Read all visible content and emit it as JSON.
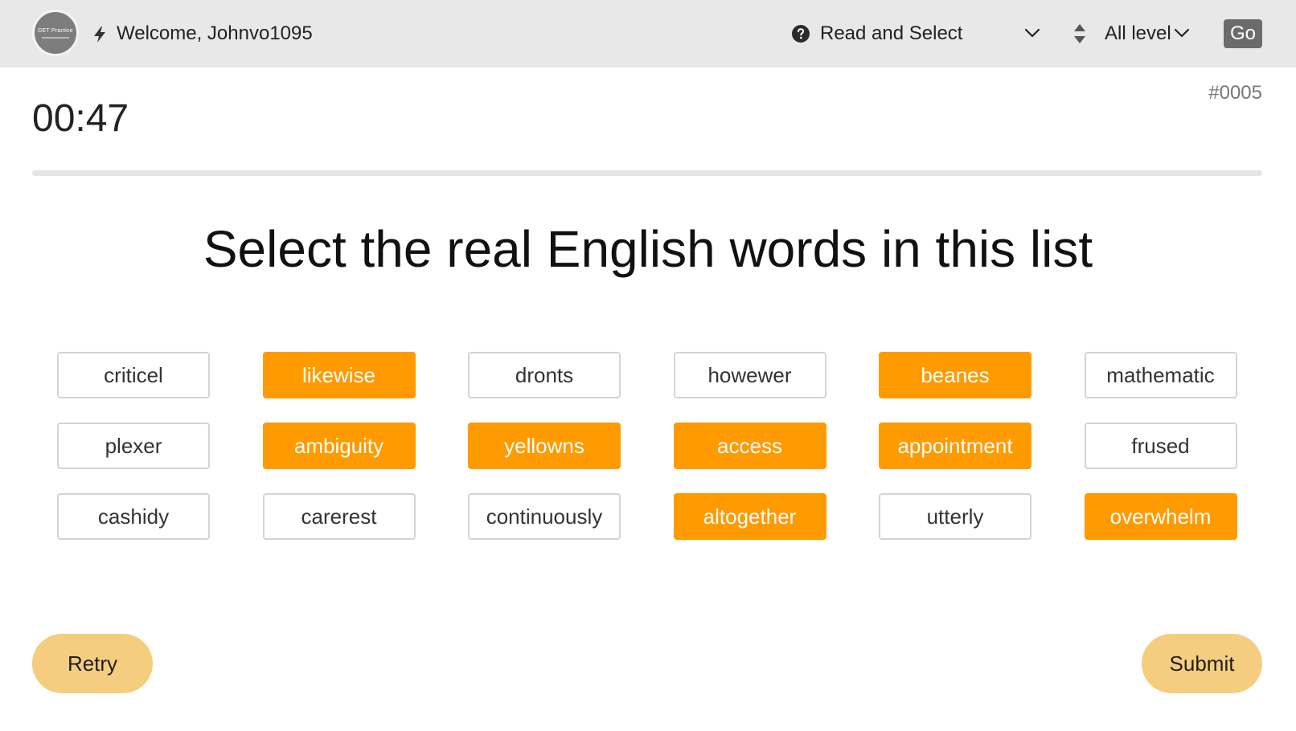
{
  "header": {
    "logo_text": "DET Practice",
    "welcome": "Welcome, Johnvo1095",
    "question_type": "Read and Select",
    "level": "All level",
    "go_label": "Go"
  },
  "question": {
    "id": "#0005",
    "timer": "00:47",
    "progress": 0,
    "prompt": "Select the real English words in this list"
  },
  "words": [
    {
      "label": "criticel",
      "selected": false
    },
    {
      "label": "likewise",
      "selected": true
    },
    {
      "label": "dronts",
      "selected": false
    },
    {
      "label": "howewer",
      "selected": false
    },
    {
      "label": "beanes",
      "selected": true
    },
    {
      "label": "mathematic",
      "selected": false
    },
    {
      "label": "plexer",
      "selected": false
    },
    {
      "label": "ambiguity",
      "selected": true
    },
    {
      "label": "yellowns",
      "selected": true
    },
    {
      "label": "access",
      "selected": true
    },
    {
      "label": "appointment",
      "selected": true
    },
    {
      "label": "frused",
      "selected": false
    },
    {
      "label": "cashidy",
      "selected": false
    },
    {
      "label": "carerest",
      "selected": false
    },
    {
      "label": "continuously",
      "selected": false
    },
    {
      "label": "altogether",
      "selected": true
    },
    {
      "label": "utterly",
      "selected": false
    },
    {
      "label": "overwhelm",
      "selected": true
    }
  ],
  "actions": {
    "retry_label": "Retry",
    "submit_label": "Submit"
  },
  "colors": {
    "selected": "#ff9a00",
    "action_button": "#f5cd7e",
    "topbar": "#e8e8e8"
  }
}
